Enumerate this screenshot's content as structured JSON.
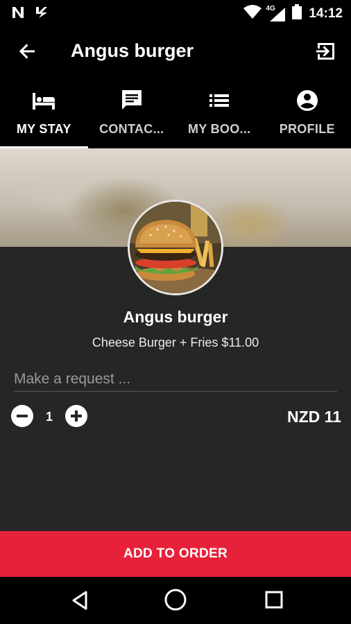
{
  "status_bar": {
    "time": "14:12",
    "network": "4G",
    "left_icons": [
      "n-app-icon",
      "bolt-app-icon"
    ],
    "right_icons": [
      "wifi-icon",
      "signal-icon",
      "battery-icon"
    ]
  },
  "toolbar": {
    "title": "Angus burger",
    "back_icon": "arrow-left-icon",
    "exit_icon": "exit-icon"
  },
  "tabs": [
    {
      "label": "MY STAY",
      "icon": "bed-icon",
      "active": true
    },
    {
      "label": "CONTAC...",
      "icon": "message-icon",
      "active": false
    },
    {
      "label": "MY BOO...",
      "icon": "list-icon",
      "active": false
    },
    {
      "label": "PROFILE",
      "icon": "account-icon",
      "active": false
    }
  ],
  "item": {
    "name": "Angus burger",
    "description": "Cheese Burger + Fries $11.00"
  },
  "request": {
    "placeholder": "Make a request ...",
    "value": ""
  },
  "quantity": {
    "value": "1",
    "price": "NZD 11"
  },
  "add_button": {
    "label": "ADD TO ORDER"
  },
  "colors": {
    "accent": "#e8213a",
    "panel": "#262626",
    "background": "#000000"
  }
}
